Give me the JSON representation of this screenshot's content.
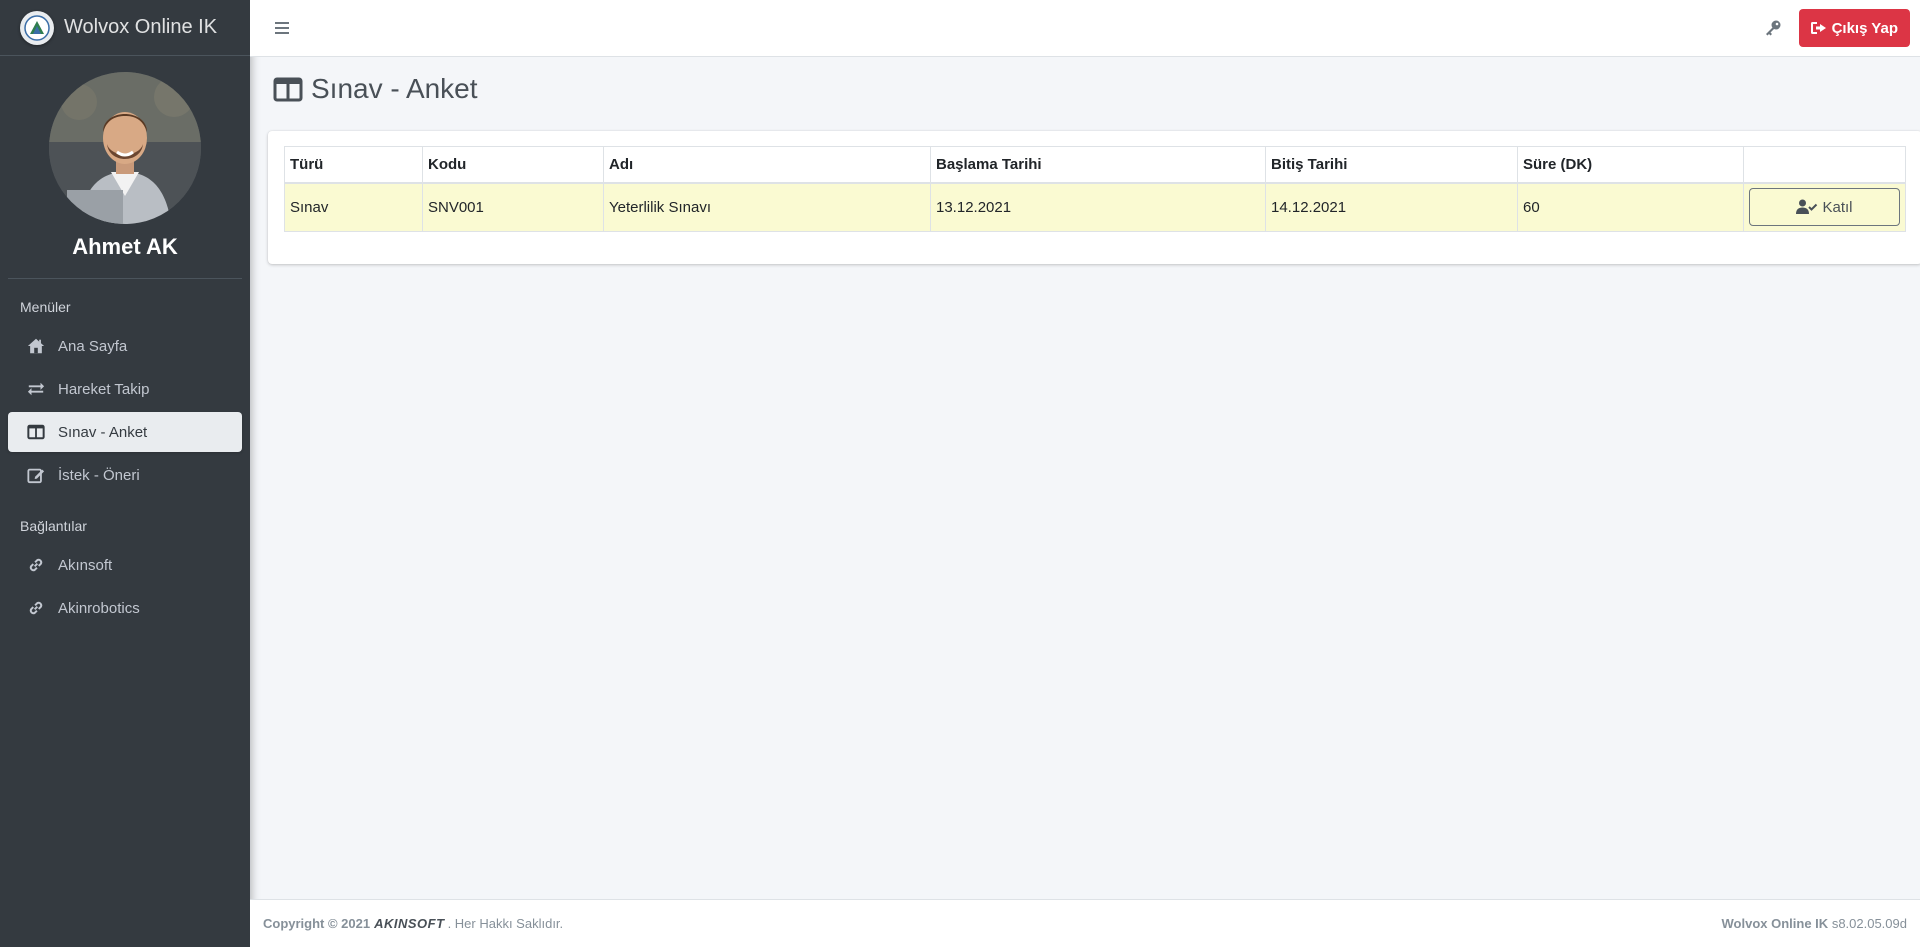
{
  "brand": {
    "title": "Wolvox Online IK"
  },
  "user": {
    "name": "Ahmet AK"
  },
  "sidebar": {
    "menu_header": "Menüler",
    "items": [
      {
        "label": "Ana Sayfa",
        "icon": "home-icon"
      },
      {
        "label": "Hareket Takip",
        "icon": "exchange-icon"
      },
      {
        "label": "Sınav - Anket",
        "icon": "columns-icon",
        "active": true
      },
      {
        "label": "İstek - Öneri",
        "icon": "edit-icon"
      }
    ],
    "links_header": "Bağlantılar",
    "links": [
      {
        "label": "Akınsoft",
        "icon": "link-icon"
      },
      {
        "label": "Akinrobotics",
        "icon": "link-icon"
      }
    ]
  },
  "topbar": {
    "logout_label": "Çıkış Yap"
  },
  "page": {
    "title": "Sınav - Anket"
  },
  "table": {
    "headers": [
      "Türü",
      "Kodu",
      "Adı",
      "Başlama Tarihi",
      "Bitiş Tarihi",
      "Süre (DK)",
      ""
    ],
    "rows": [
      {
        "type": "Sınav",
        "code": "SNV001",
        "name": "Yeterlilik Sınavı",
        "start": "13.12.2021",
        "end": "14.12.2021",
        "duration": "60",
        "action": "Katıl"
      }
    ]
  },
  "footer": {
    "copyright": "Copyright © 2021",
    "company": "AKINSOFT",
    "rights": ". Her Hakkı Saklıdır.",
    "app_name": "Wolvox Online IK",
    "version": "s8.02.05.09d"
  },
  "colors": {
    "sidebar_bg": "#343a40",
    "logout_red": "#dc3545",
    "row_highlight": "#fafad2"
  }
}
